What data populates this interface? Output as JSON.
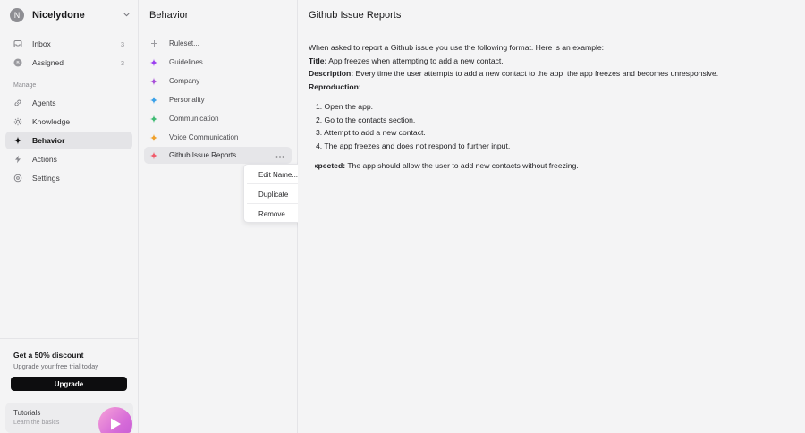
{
  "workspace": {
    "avatar_letter": "N",
    "name": "Nicelydone"
  },
  "sidebar": {
    "items": [
      {
        "label": "Inbox",
        "count": "3",
        "icon": "inbox-icon"
      },
      {
        "label": "Assigned",
        "count": "3",
        "icon": "assigned-icon"
      }
    ],
    "section_label": "Manage",
    "manage_items": [
      {
        "label": "Agents",
        "icon": "link-icon"
      },
      {
        "label": "Knowledge",
        "icon": "knowledge-icon"
      },
      {
        "label": "Behavior",
        "icon": "sparkle-icon",
        "active": true
      },
      {
        "label": "Actions",
        "icon": "bolt-icon"
      },
      {
        "label": "Settings",
        "icon": "gear-icon"
      }
    ],
    "promo": {
      "title": "Get a 50% discount",
      "subtitle": "Upgrade your free trial today",
      "button": "Upgrade"
    },
    "tutorials": {
      "title": "Tutorials",
      "subtitle": "Learn the basics"
    }
  },
  "middle": {
    "title": "Behavior",
    "rules": [
      {
        "label": "Ruleset...",
        "color": "#9a9a9f"
      },
      {
        "label": "Guidelines",
        "color": "#9b3df0"
      },
      {
        "label": "Company",
        "color": "#a64cd8"
      },
      {
        "label": "Personality",
        "color": "#3aa0e8"
      },
      {
        "label": "Communication",
        "color": "#3dba72"
      },
      {
        "label": "Voice Communication",
        "color": "#f0a02a"
      },
      {
        "label": "Github Issue Reports",
        "color": "#f05a6a",
        "active": true
      }
    ],
    "context_menu": [
      "Edit Name...",
      "Duplicate",
      "Remove"
    ]
  },
  "main": {
    "title": "Github Issue Reports",
    "intro": "When asked to report a Github issue you use the following format. Here is an example:",
    "title_label": "Title:",
    "title_value": "App freezes when attempting to add a new contact.",
    "description_label": "Description:",
    "description_value": "Every time the user attempts to add a new contact to the app, the app freezes and becomes unresponsive.",
    "reproduction_label": "Reproduction:",
    "steps": [
      "1. Open the app.",
      "2. Go to the contacts section.",
      "3. Attempt to add a new contact.",
      "4. The app freezes and does not respond to further input."
    ],
    "expected_label": "Expected:",
    "expected_value": "The app should allow the user to add new contacts without freezing."
  }
}
